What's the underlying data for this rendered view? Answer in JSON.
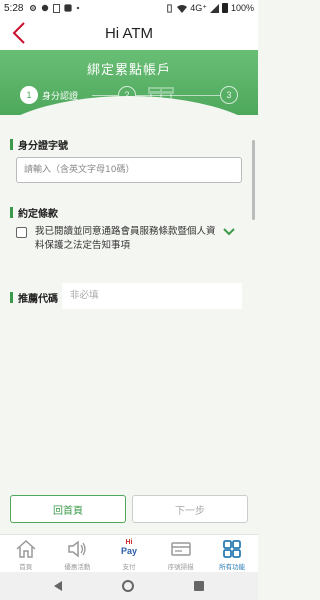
{
  "status_bar": {
    "time": "5:28",
    "network": "4G⁺",
    "battery": "100%"
  },
  "header": {
    "title": "Hi ATM"
  },
  "banner": {
    "title": "綁定累點帳戶",
    "steps": [
      {
        "number": "1",
        "label": "身分認證",
        "active": true
      },
      {
        "number": "2",
        "active": false
      },
      {
        "number": "3",
        "active": false
      }
    ]
  },
  "form": {
    "id_section_title": "身分證字號",
    "id_placeholder": "請輸入（含英文字母10碼）",
    "terms_section_title": "約定條款",
    "terms_text": "我已閱讀並同意通路會員服務條款暨個人資料保護之法定告知事項",
    "terms_checked": false,
    "referral_label": "推薦代碼",
    "referral_placeholder": "非必填"
  },
  "buttons": {
    "home": "回首頁",
    "next": "下一步"
  },
  "tabbar": {
    "items": [
      {
        "label": "首頁",
        "icon": "home-icon",
        "active": false
      },
      {
        "label": "優惠活動",
        "icon": "speaker-icon",
        "active": false
      },
      {
        "label": "支付",
        "icon": "hipay-logo",
        "active": false,
        "logo_top": "Hi",
        "logo_bottom": "Pay"
      },
      {
        "label": "序號掃描",
        "icon": "card-icon",
        "active": false
      },
      {
        "label": "所有功能",
        "icon": "grid-icon",
        "active": true
      }
    ]
  },
  "colors": {
    "brand_green": "#4ea85c",
    "active_blue": "#2a7bb5",
    "back_red": "#c8102e"
  }
}
